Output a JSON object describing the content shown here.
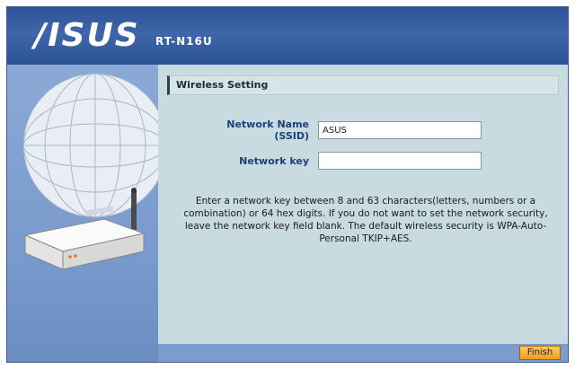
{
  "header": {
    "logo": "/ISUS",
    "model": "RT-N16U"
  },
  "section": {
    "title": "Wireless Setting"
  },
  "form": {
    "ssid_label": "Network Name (SSID)",
    "ssid_value": "ASUS",
    "key_label": "Network key",
    "key_value": ""
  },
  "description": "Enter a network key between 8 and 63 characters(letters, numbers or a combination) or 64 hex digits. If you do not want to set the network security, leave the network key field blank. The default wireless security is WPA-Auto-Personal TKIP+AES.",
  "footer": {
    "finish_label": "Finish"
  },
  "colors": {
    "header": "#2c5396",
    "content_bg": "#c7dbe0",
    "label": "#1f3f7a",
    "finish_button": "#f09a1e"
  }
}
